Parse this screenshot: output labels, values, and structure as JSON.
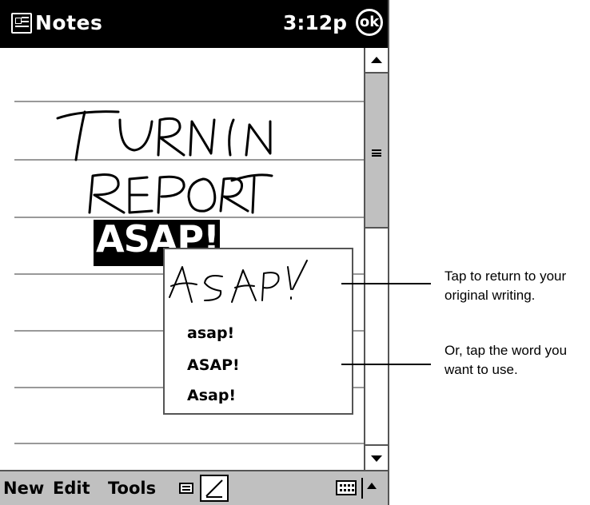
{
  "titlebar": {
    "app_name": "Notes",
    "time": "3:12p",
    "ok_label": "ok"
  },
  "note": {
    "highlighted_word": "ASAP!"
  },
  "popup": {
    "options": [
      "asap!",
      "ASAP!",
      "Asap!"
    ]
  },
  "menubar": {
    "new_label": "New",
    "edit_label": "Edit",
    "tools_label": "Tools"
  },
  "callouts": {
    "first_line1": "Tap to return to your",
    "first_line2": "original writing.",
    "second_line1": "Or, tap the word you",
    "second_line2": "want to use."
  }
}
